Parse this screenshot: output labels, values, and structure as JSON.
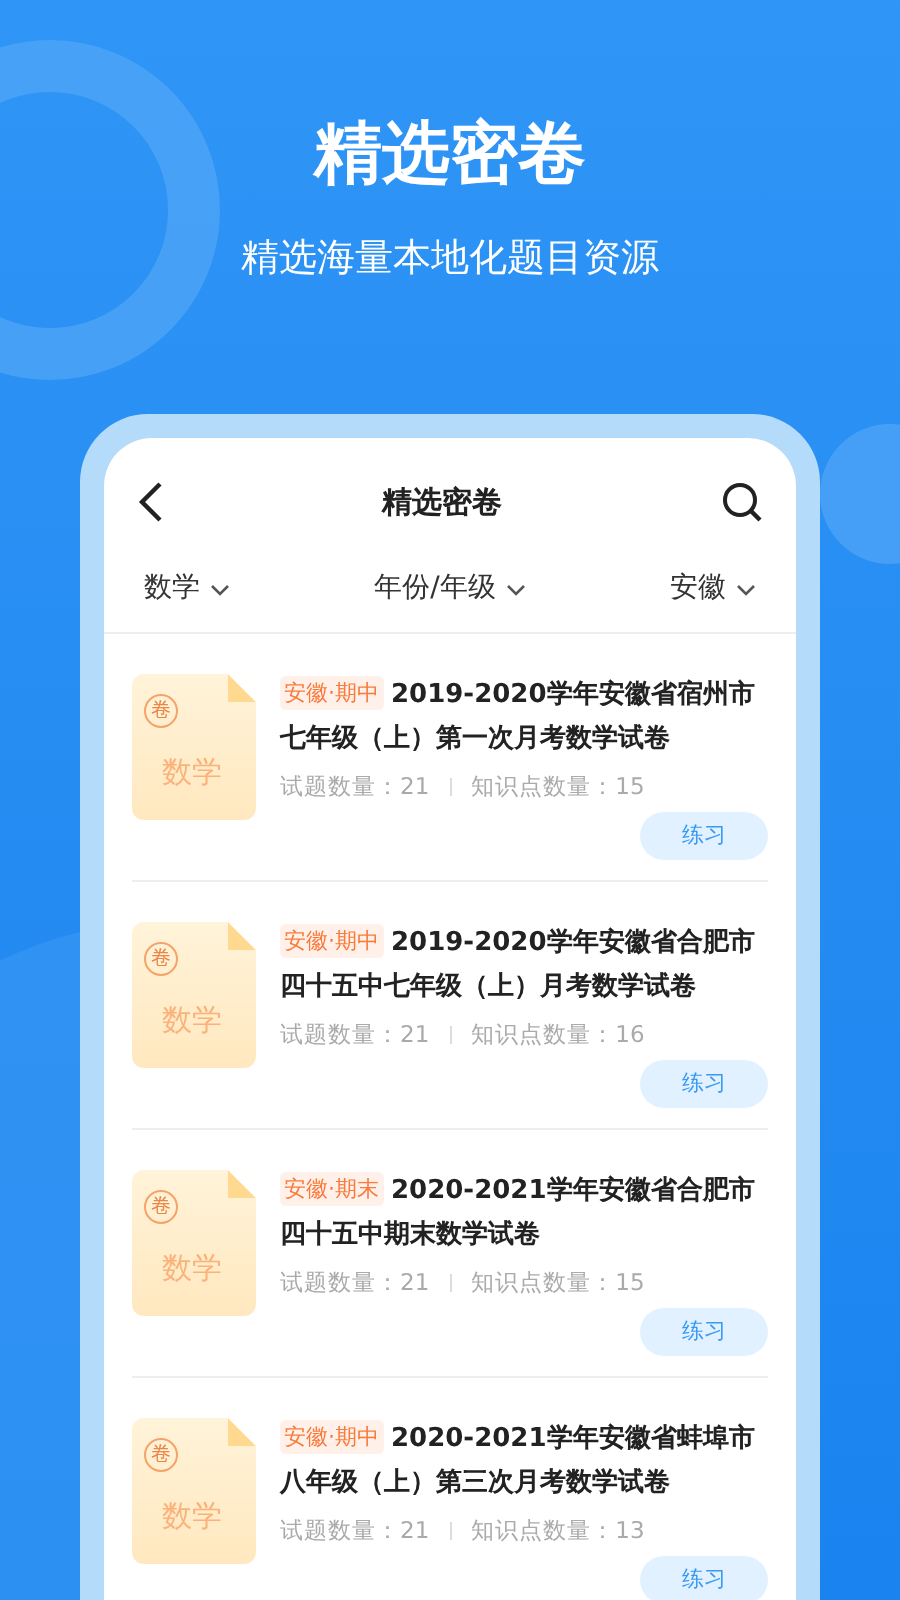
{
  "headline": "精选密卷",
  "subheadline": "精选海量本地化题目资源",
  "screen": {
    "title": "精选密卷",
    "filters": [
      {
        "label": "数学"
      },
      {
        "label": "年份/年级"
      },
      {
        "label": "安徽"
      }
    ],
    "papers": [
      {
        "thumb_badge": "卷",
        "thumb_subject": "数学",
        "tag": "安徽·期中",
        "title": "2019-2020学年安徽省宿州市七年级（上）第一次月考数学试卷",
        "questions": "试题数量：21",
        "points": "知识点数量：15",
        "action": "练习"
      },
      {
        "thumb_badge": "卷",
        "thumb_subject": "数学",
        "tag": "安徽·期中",
        "title": "2019-2020学年安徽省合肥市四十五中七年级（上）月考数学试卷",
        "questions": "试题数量：21",
        "points": "知识点数量：16",
        "action": "练习"
      },
      {
        "thumb_badge": "卷",
        "thumb_subject": "数学",
        "tag": "安徽·期末",
        "title": "2020-2021学年安徽省合肥市四十五中期末数学试卷",
        "questions": "试题数量：21",
        "points": "知识点数量：15",
        "action": "练习"
      },
      {
        "thumb_badge": "卷",
        "thumb_subject": "数学",
        "tag": "安徽·期中",
        "title": "2020-2021学年安徽省蚌埠市八年级（上）第三次月考数学试卷",
        "questions": "试题数量：21",
        "points": "知识点数量：13",
        "action": "练习"
      }
    ]
  }
}
